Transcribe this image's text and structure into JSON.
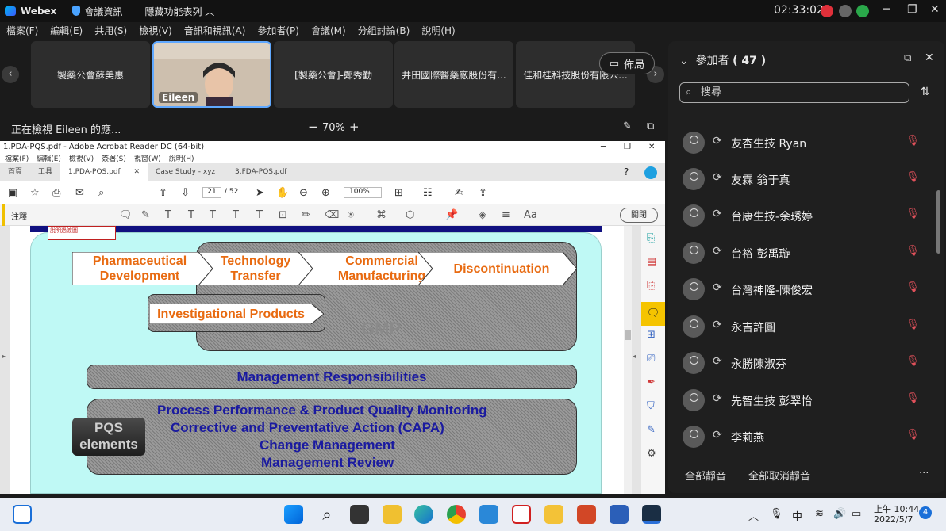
{
  "topbar": {
    "app": "Webex",
    "meeting_info": "會議資訊",
    "hide_menu": "隱藏功能表列",
    "clock": "02:33:02"
  },
  "menu": [
    "檔案(F)",
    "編輯(E)",
    "共用(S)",
    "檢視(V)",
    "音訊和視訊(A)",
    "參加者(P)",
    "會議(M)",
    "分組討論(B)",
    "說明(H)"
  ],
  "thumbs": [
    {
      "label": "製藥公會蘇美惠"
    },
    {
      "label": "Eileen"
    },
    {
      "label": "[製藥公會]-鄭秀勤"
    },
    {
      "label": "井田國際醫藥廠股份有..."
    },
    {
      "label": "佳和桂科技股份有限公..."
    }
  ],
  "layout_label": "佈局",
  "view": {
    "status": "正在檢視 Eileen 的應...",
    "zoom": "70%",
    "minus": "−",
    "plus": "+"
  },
  "acrobat": {
    "title": "1.PDA-PQS.pdf - Adobe Acrobat Reader DC (64-bit)",
    "menu": [
      "檔案(F)",
      "編輯(E)",
      "檢視(V)",
      "簽署(S)",
      "視窗(W)",
      "說明(H)"
    ],
    "tabs": [
      "首頁",
      "工具",
      "1.PDA-PQS.pdf",
      "Case Study - xyz",
      "3.FDA-PQS.pdf"
    ],
    "page": "21",
    "pages": "/ 52",
    "zoom": "100%",
    "annotate": "注釋",
    "close": "關閉",
    "redbox": "說明過渡圖"
  },
  "slide": {
    "arrows": [
      "Pharmaceutical Development",
      "Technology Transfer",
      "Commercial Manufacturing",
      "Discontinuation"
    ],
    "investigational": "Investigational Products",
    "gmp": "GMP",
    "management": "Management Responsibilities",
    "pqs_lines": [
      "Process Performance & Product Quality Monitoring",
      "Corrective and Preventative Action  (CAPA)",
      "Change Management",
      "Management Review"
    ],
    "badge_1": "PQS",
    "badge_2": "elements"
  },
  "participants": {
    "header": "參加者",
    "count": "( 47 )",
    "search_placeholder": "搜尋",
    "list": [
      "友杏生技 Ryan",
      "友霖 翁于真",
      "台康生技-余琇婷",
      "台裕 彭禹璇",
      "台灣神隆-陳俊宏",
      "永吉許圓",
      "永勝陳淑芬",
      "先智生技 彭翠怡",
      "李莉燕"
    ],
    "mute_all": "全部靜音",
    "unmute_all": "全部取消靜音",
    "more": "..."
  },
  "taskbar": {
    "time": "上午 10:44",
    "date": "2022/5/7",
    "ime": "中",
    "badge": "4"
  }
}
